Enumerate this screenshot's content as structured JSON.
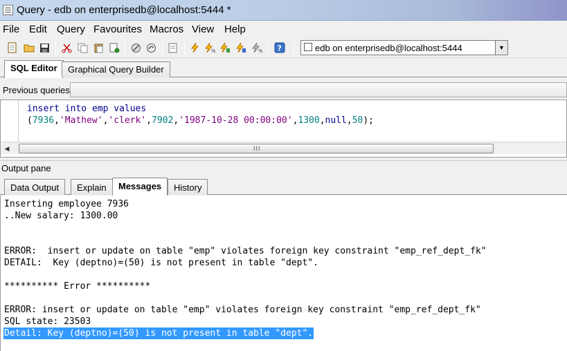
{
  "window": {
    "title": "Query - edb on enterprisedb@localhost:5444 *"
  },
  "menu": [
    "File",
    "Edit",
    "Query",
    "Favourites",
    "Macros",
    "View",
    "Help"
  ],
  "toolbar": {
    "icons": [
      "open-file-icon",
      "open-folder-icon",
      "save-icon",
      "cut-icon",
      "copy-icon",
      "paste-icon",
      "export-icon",
      "cancel-icon",
      "clear-icon",
      "find-icon",
      "execute-icon",
      "execute-pgscript-icon",
      "execute-to-file-icon",
      "explain-icon",
      "explain-analyze-icon",
      "help-icon"
    ],
    "connection": "edb on enterprisedb@localhost:5444"
  },
  "editor_tabs": [
    "SQL Editor",
    "Graphical Query Builder"
  ],
  "previous_queries_label": "Previous queries",
  "sql": {
    "line1": [
      "insert",
      "into",
      "emp",
      "values"
    ],
    "line2": {
      "open": "(",
      "empno": "7936",
      "ename": "'Mathew'",
      "job": "'clerk'",
      "mgr": "7902",
      "hiredate": "'1987-10-28 00:00:00'",
      "sal": "1300",
      "comm": "null",
      "deptno": "50",
      "close": ");"
    }
  },
  "output_pane_label": "Output pane",
  "output_tabs": [
    "Data Output",
    "Explain",
    "Messages",
    "History"
  ],
  "messages": [
    "Inserting employee 7936",
    "..New salary: 1300.00",
    "ERROR:  insert or update on table \"emp\" violates foreign key constraint \"emp_ref_dept_fk\"",
    "DETAIL:  Key (deptno)=(50) is not present in table \"dept\".",
    "********** Error **********",
    "ERROR: insert or update on table \"emp\" violates foreign key constraint \"emp_ref_dept_fk\"",
    "SQL state: 23503",
    "Detail: Key (deptno)=(50) is not present in table \"dept\"."
  ]
}
